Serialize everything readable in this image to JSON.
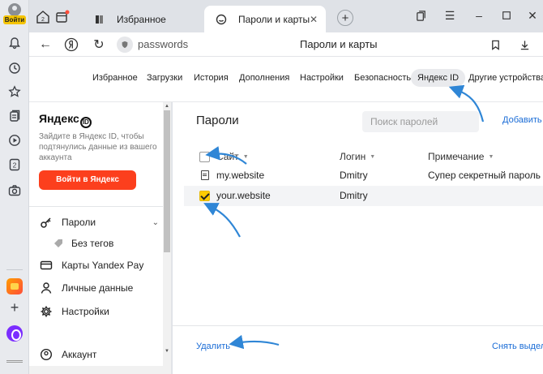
{
  "side_panel": {
    "login_badge": "Войти",
    "icons": [
      "bell-icon",
      "clock-icon",
      "star-icon",
      "collections-icon",
      "play-icon",
      "two-icon",
      "camera-icon",
      "yandex-app-icon",
      "plus-icon",
      "alice-icon"
    ],
    "two_label": "2"
  },
  "tabs": {
    "inactive_label": "Избранное",
    "active_label": "Пароли и карты",
    "counter_label": "2"
  },
  "address": {
    "url": "passwords",
    "page_title": "Пароли и карты"
  },
  "settings_nav": {
    "items": [
      "Избранное",
      "Загрузки",
      "История",
      "Дополнения",
      "Настройки",
      "Безопасность",
      "Яндекс ID",
      "Другие устройства"
    ],
    "active": "Яндекс ID"
  },
  "left_panel": {
    "brand": "Яндекс",
    "brand_id": "ID",
    "promo_text": "Зайдите в Яндекс ID, чтобы подтянулись данные из вашего аккаунта",
    "login_button": "Войти в Яндекс",
    "menu": [
      {
        "label": "Пароли",
        "icon": "key-icon"
      },
      {
        "label": "Без тегов",
        "icon": "tag-icon"
      },
      {
        "label": "Карты Yandex Pay",
        "icon": "card-icon"
      },
      {
        "label": "Личные данные",
        "icon": "person-icon"
      },
      {
        "label": "Настройки",
        "icon": "gear-icon"
      },
      {
        "label": "Аккаунт",
        "icon": "account-icon"
      }
    ]
  },
  "passwords": {
    "heading": "Пароли",
    "search_placeholder": "Поиск паролей",
    "add_link": "Добавить",
    "columns": {
      "site": "Сайт",
      "login": "Логин",
      "note": "Примечание"
    },
    "rows": [
      {
        "site": "my.website",
        "login": "Dmitry",
        "note": "Супер секретный пароль",
        "checked": false
      },
      {
        "site": "your.website",
        "login": "Dmitry",
        "note": "",
        "checked": true
      }
    ],
    "delete_link": "Удалить",
    "deselect_link": "Снять выделение"
  },
  "colors": {
    "accent_link": "#1a6cd6",
    "login_button": "#fc3f1d",
    "checkbox_checked": "#ffcc00",
    "arrow": "#2f86d6"
  }
}
